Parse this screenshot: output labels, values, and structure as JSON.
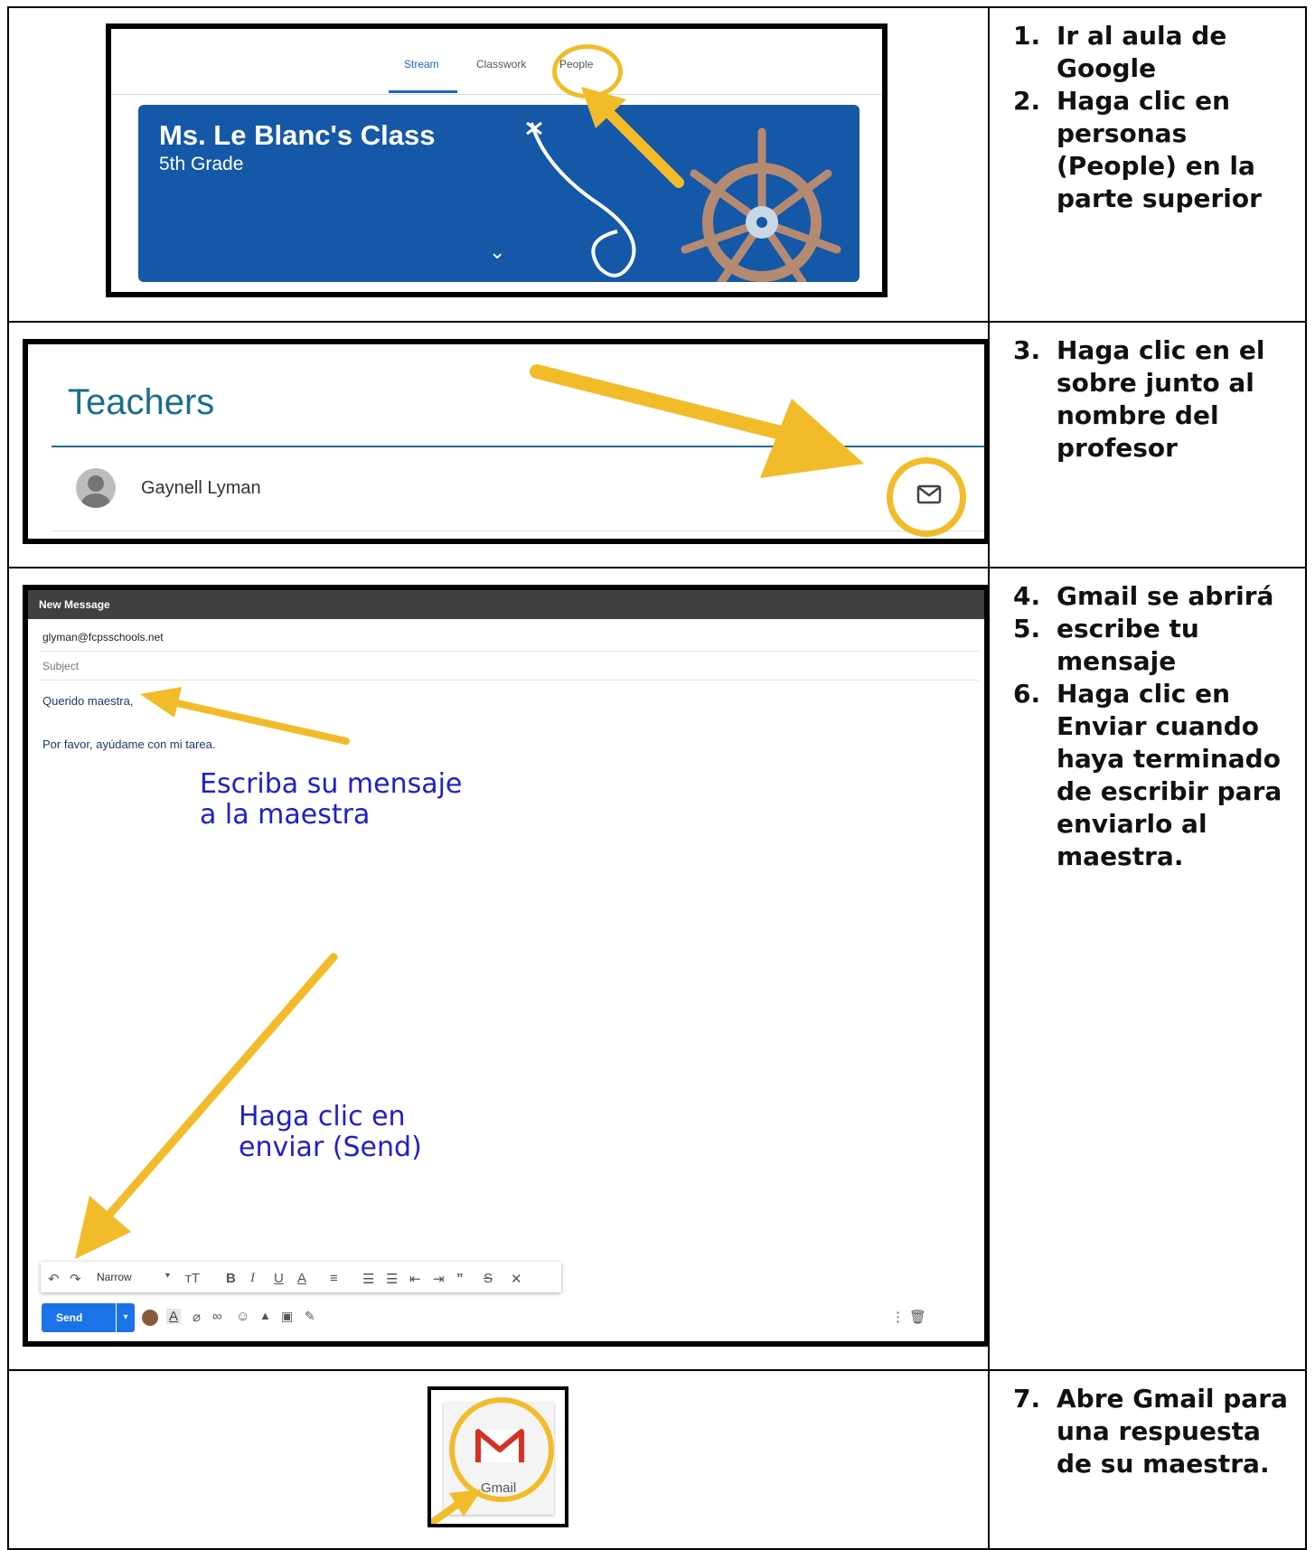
{
  "rows": [
    {
      "steps": [
        {
          "num": "1.",
          "text": "Ir al aula de Google"
        },
        {
          "num": "2.",
          "text": "Haga clic en personas (People) en la parte superior"
        }
      ]
    },
    {
      "steps": [
        {
          "num": "3.",
          "text": "Haga clic en el sobre junto al nombre del profesor"
        }
      ]
    },
    {
      "steps": [
        {
          "num": "4.",
          "text": "Gmail se abrirá"
        },
        {
          "num": "5.",
          "text": "escribe tu mensaje"
        },
        {
          "num": "6.",
          "text": "Haga clic en Enviar cuando haya terminado de escribir para enviarlo al maestra."
        }
      ]
    },
    {
      "steps": [
        {
          "num": "7.",
          "text": "Abre Gmail para una respuesta de su maestra."
        }
      ]
    }
  ],
  "classroom": {
    "tabs": [
      "Stream",
      "Classwork",
      "People"
    ],
    "class_name": "Ms. Le Blanc's Class",
    "section": "5th Grade",
    "chevron": "⌄"
  },
  "people": {
    "heading": "Teachers",
    "teacher_name": "Gaynell Lyman"
  },
  "compose": {
    "title": "New Message",
    "to": "glyman@fcpsschools.net",
    "subject_placeholder": "Subject",
    "body_line1": "Querido maestra,",
    "body_line2": "Por favor, ayúdame con mi tarea.",
    "annotation1": "Escriba su mensaje a la maestra",
    "annotation2": "Haga clic en enviar (Send)",
    "font_name": "Narrow",
    "send_label": "Send"
  },
  "gmail": {
    "label": "Gmail"
  },
  "colors": {
    "arrow": "#F2BB2A",
    "banner": "#1558A8",
    "send": "#1A73E8",
    "handwriting": "#2020C8",
    "gmail_red": "#D93025"
  }
}
